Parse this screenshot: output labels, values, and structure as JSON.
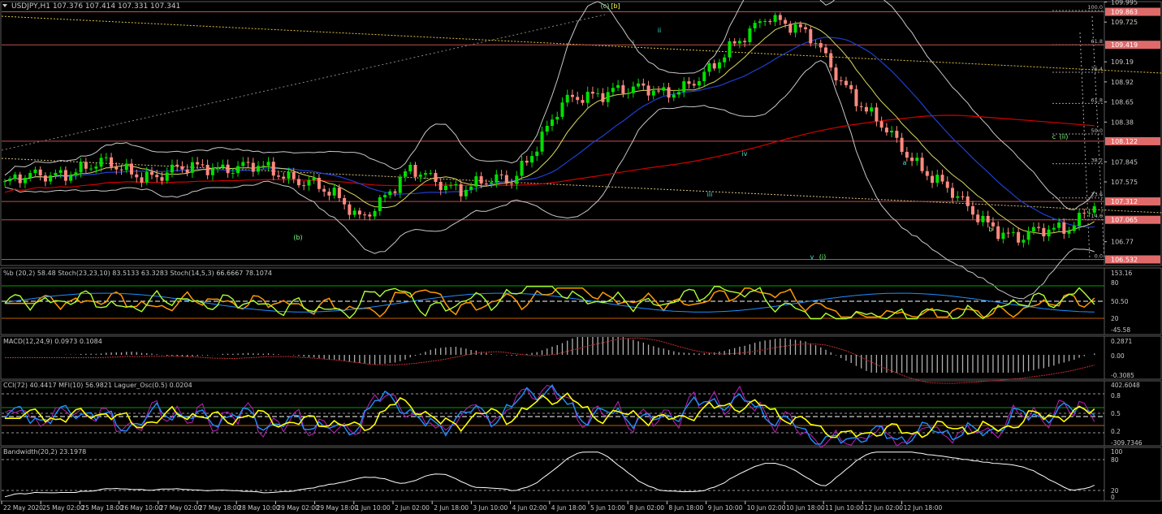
{
  "header": {
    "symbol_line": "USDJPY,H1  107.376 107.414 107.331 107.341"
  },
  "colors": {
    "bg": "#000000",
    "grid": "#3a3a3a",
    "axis_text": "#c8c8c8",
    "bull": "#00e000",
    "bear": "#ff8a80",
    "level": "#c0504d",
    "level_label_bg": "#e06a6a",
    "ma_red": "#d40000",
    "ma_blue": "#1f3fcf",
    "ma_yellow": "#d8d860",
    "bands": "#c8c8c8",
    "stoch_green": "#adff2f",
    "stoch_orange": "#ff9900",
    "stoch_blue": "#1e90ff",
    "macd_hist": "#b0b0b0",
    "macd_signal": "#c03030",
    "cci_blue": "#1e90ff",
    "mfi_magenta": "#c020c0",
    "laguerre_yellow": "#ffff00",
    "bandwidth_white": "#ffffff",
    "wave_green": "#7fff7f",
    "wave_cyan": "#40e0d0"
  },
  "chart_data": [
    {
      "panel": "price",
      "type": "line",
      "title": "USDJPY,H1",
      "ylim": [
        106.45,
        110.0
      ],
      "y_ticks": [
        109.995,
        109.725,
        109.19,
        108.92,
        108.65,
        108.38,
        107.845,
        107.575,
        106.77
      ],
      "price_level_labels": [
        "109.863",
        "109.419",
        "108.122",
        "107.312",
        "107.065",
        "106.532"
      ],
      "fib_levels": [
        {
          "label": "100.0",
          "value": 109.88
        },
        {
          "label": "61.8",
          "value": 109.42
        },
        {
          "label": "76.4",
          "value": 109.05
        },
        {
          "label": "61.8",
          "value": 108.63
        },
        {
          "label": "50.0",
          "value": 108.22
        },
        {
          "label": "38.2",
          "value": 107.82
        },
        {
          "label": "23.6",
          "value": 107.36
        },
        {
          "label": "14.6",
          "value": 107.07
        },
        {
          "label": "0.0",
          "value": 106.53
        }
      ],
      "wave_labels": [
        "(c)",
        "[b]",
        "(b)",
        "ii",
        "i",
        "iii",
        "iv",
        "v",
        "(i)",
        "a",
        "b",
        "c",
        "(ii)"
      ],
      "x_labels": [
        "22 May 2020",
        "25 May 02:00",
        "25 May 18:00",
        "26 May 10:00",
        "27 May 02:00",
        "27 May 18:00",
        "28 May 10:00",
        "29 May 02:00",
        "29 May 18:00",
        "1 Jun 10:00",
        "2 Jun 02:00",
        "2 Jun 18:00",
        "3 Jun 10:00",
        "4 Jun 02:00",
        "4 Jun 18:00",
        "5 Jun 10:00",
        "8 Jun 02:00",
        "8 Jun 18:00",
        "9 Jun 10:00",
        "10 Jun 02:00",
        "10 Jun 18:00",
        "11 Jun 10:00",
        "12 Jun 02:00",
        "12 Jun 18:00"
      ],
      "series": [
        {
          "name": "USDJPY,H1",
          "x": [
            0,
            10,
            20,
            30,
            40,
            50,
            60,
            70,
            80,
            85,
            90,
            100,
            110,
            120,
            130,
            140,
            150,
            160,
            170,
            180,
            190,
            200,
            210,
            216
          ],
          "values": [
            107.55,
            107.7,
            107.8,
            107.65,
            107.8,
            107.75,
            107.6,
            107.1,
            107.7,
            107.6,
            107.5,
            107.6,
            108.6,
            108.85,
            108.75,
            109.1,
            109.85,
            109.45,
            108.5,
            107.85,
            107.2,
            106.8,
            107.0,
            107.34
          ]
        }
      ]
    },
    {
      "panel": "stoch",
      "type": "line",
      "title": "%b (20,2) 58.48  Stoch(23,23,10) 83.5133 63.3283  Stoch(14,5,3) 66.6667 78.1074",
      "y_ticks": [
        "153.16",
        "80",
        "50.50",
        "20",
        "-45.58"
      ]
    },
    {
      "panel": "macd",
      "type": "bar",
      "title": "MACD(12,24,9) 0.0973 0.1084",
      "y_ticks": [
        "0.2871",
        "0.00",
        "-0.3085"
      ]
    },
    {
      "panel": "cci",
      "type": "line",
      "title": "CCI(72) 40.4417  MFI(10) 56.9821  Laguer_Osc(0.5) 0.0204",
      "y_ticks": [
        "402.6048",
        "0.8",
        "0.5",
        "0.2",
        "-309.7346"
      ]
    },
    {
      "panel": "bandwidth",
      "type": "line",
      "title": "Bandwidth(20,2) 23.1978",
      "y_ticks": [
        "100",
        "80",
        "20",
        "0"
      ]
    }
  ]
}
